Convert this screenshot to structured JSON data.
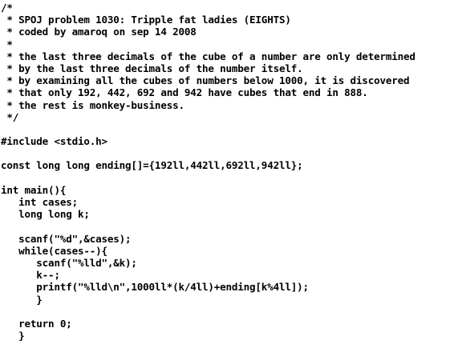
{
  "document": {
    "lines": [
      "/*",
      " * SPOJ problem 1030: Tripple fat ladies (EIGHTS)",
      " * coded by amaroq on sep 14 2008",
      " *",
      " * the last three decimals of the cube of a number are only determined",
      " * by the last three decimals of the number itself.",
      " * by examining all the cubes of numbers below 1000, it is discovered",
      " * that only 192, 442, 692 and 942 have cubes that end in 888.",
      " * the rest is monkey-business.",
      " */",
      "",
      "#include <stdio.h>",
      "",
      "const long long ending[]={192ll,442ll,692ll,942ll};",
      "",
      "int main(){",
      "   int cases;",
      "   long long k;",
      "",
      "   scanf(\"%d\",&cases);",
      "   while(cases--){",
      "      scanf(\"%lld\",&k);",
      "      k--;",
      "      printf(\"%lld\\n\",1000ll*(k/4ll)+ending[k%4ll]);",
      "      }",
      "",
      "   return 0;",
      "   }"
    ]
  }
}
